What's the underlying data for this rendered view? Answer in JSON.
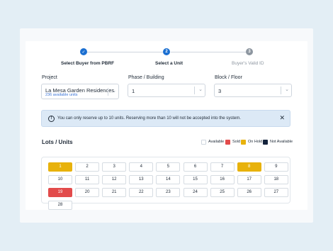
{
  "stepper": {
    "steps": [
      {
        "label": "Select Buyer from PBRF",
        "number": "✓",
        "state": "done"
      },
      {
        "label": "Select a Unit",
        "number": "2",
        "state": "active"
      },
      {
        "label": "Buyer's Valid ID",
        "number": "3",
        "state": "pending"
      }
    ]
  },
  "fields": {
    "project": {
      "label": "Project",
      "value": "La Mesa Garden Residences",
      "sub": "236 available units"
    },
    "phase": {
      "label": "Phase / Building",
      "value": "1"
    },
    "block": {
      "label": "Block / Floor",
      "value": "3"
    }
  },
  "alert": {
    "icon": "info-icon",
    "message": "You can only reserve up to 10 units. Reserving more than 10 will not be accepted into the system."
  },
  "units_section": {
    "title": "Lots / Units",
    "legend": [
      {
        "label": "Available",
        "color": "#ffffff"
      },
      {
        "label": "Sold",
        "color": "#e24b4b"
      },
      {
        "label": "On Hold",
        "color": "#e8b20c"
      },
      {
        "label": "Not Available",
        "color": "#14233c"
      }
    ],
    "units": [
      {
        "label": "1",
        "status": "hold"
      },
      {
        "label": "2",
        "status": "available"
      },
      {
        "label": "3",
        "status": "available"
      },
      {
        "label": "4",
        "status": "available"
      },
      {
        "label": "5",
        "status": "available"
      },
      {
        "label": "6",
        "status": "available"
      },
      {
        "label": "7",
        "status": "available"
      },
      {
        "label": "8",
        "status": "hold"
      },
      {
        "label": "9",
        "status": "available"
      },
      {
        "label": "10",
        "status": "available"
      },
      {
        "label": "11",
        "status": "available"
      },
      {
        "label": "12",
        "status": "available"
      },
      {
        "label": "13",
        "status": "available"
      },
      {
        "label": "14",
        "status": "available"
      },
      {
        "label": "15",
        "status": "available"
      },
      {
        "label": "16",
        "status": "available"
      },
      {
        "label": "17",
        "status": "available"
      },
      {
        "label": "18",
        "status": "available"
      },
      {
        "label": "19",
        "status": "sold"
      },
      {
        "label": "20",
        "status": "available"
      },
      {
        "label": "21",
        "status": "available"
      },
      {
        "label": "22",
        "status": "available"
      },
      {
        "label": "23",
        "status": "available"
      },
      {
        "label": "24",
        "status": "available"
      },
      {
        "label": "25",
        "status": "available"
      },
      {
        "label": "26",
        "status": "available"
      },
      {
        "label": "27",
        "status": "available"
      },
      {
        "label": "28",
        "status": "available"
      }
    ]
  },
  "colors": {
    "primary": "#1b6fd1",
    "done": "#1b6fd1",
    "pending": "#8d96a0"
  }
}
